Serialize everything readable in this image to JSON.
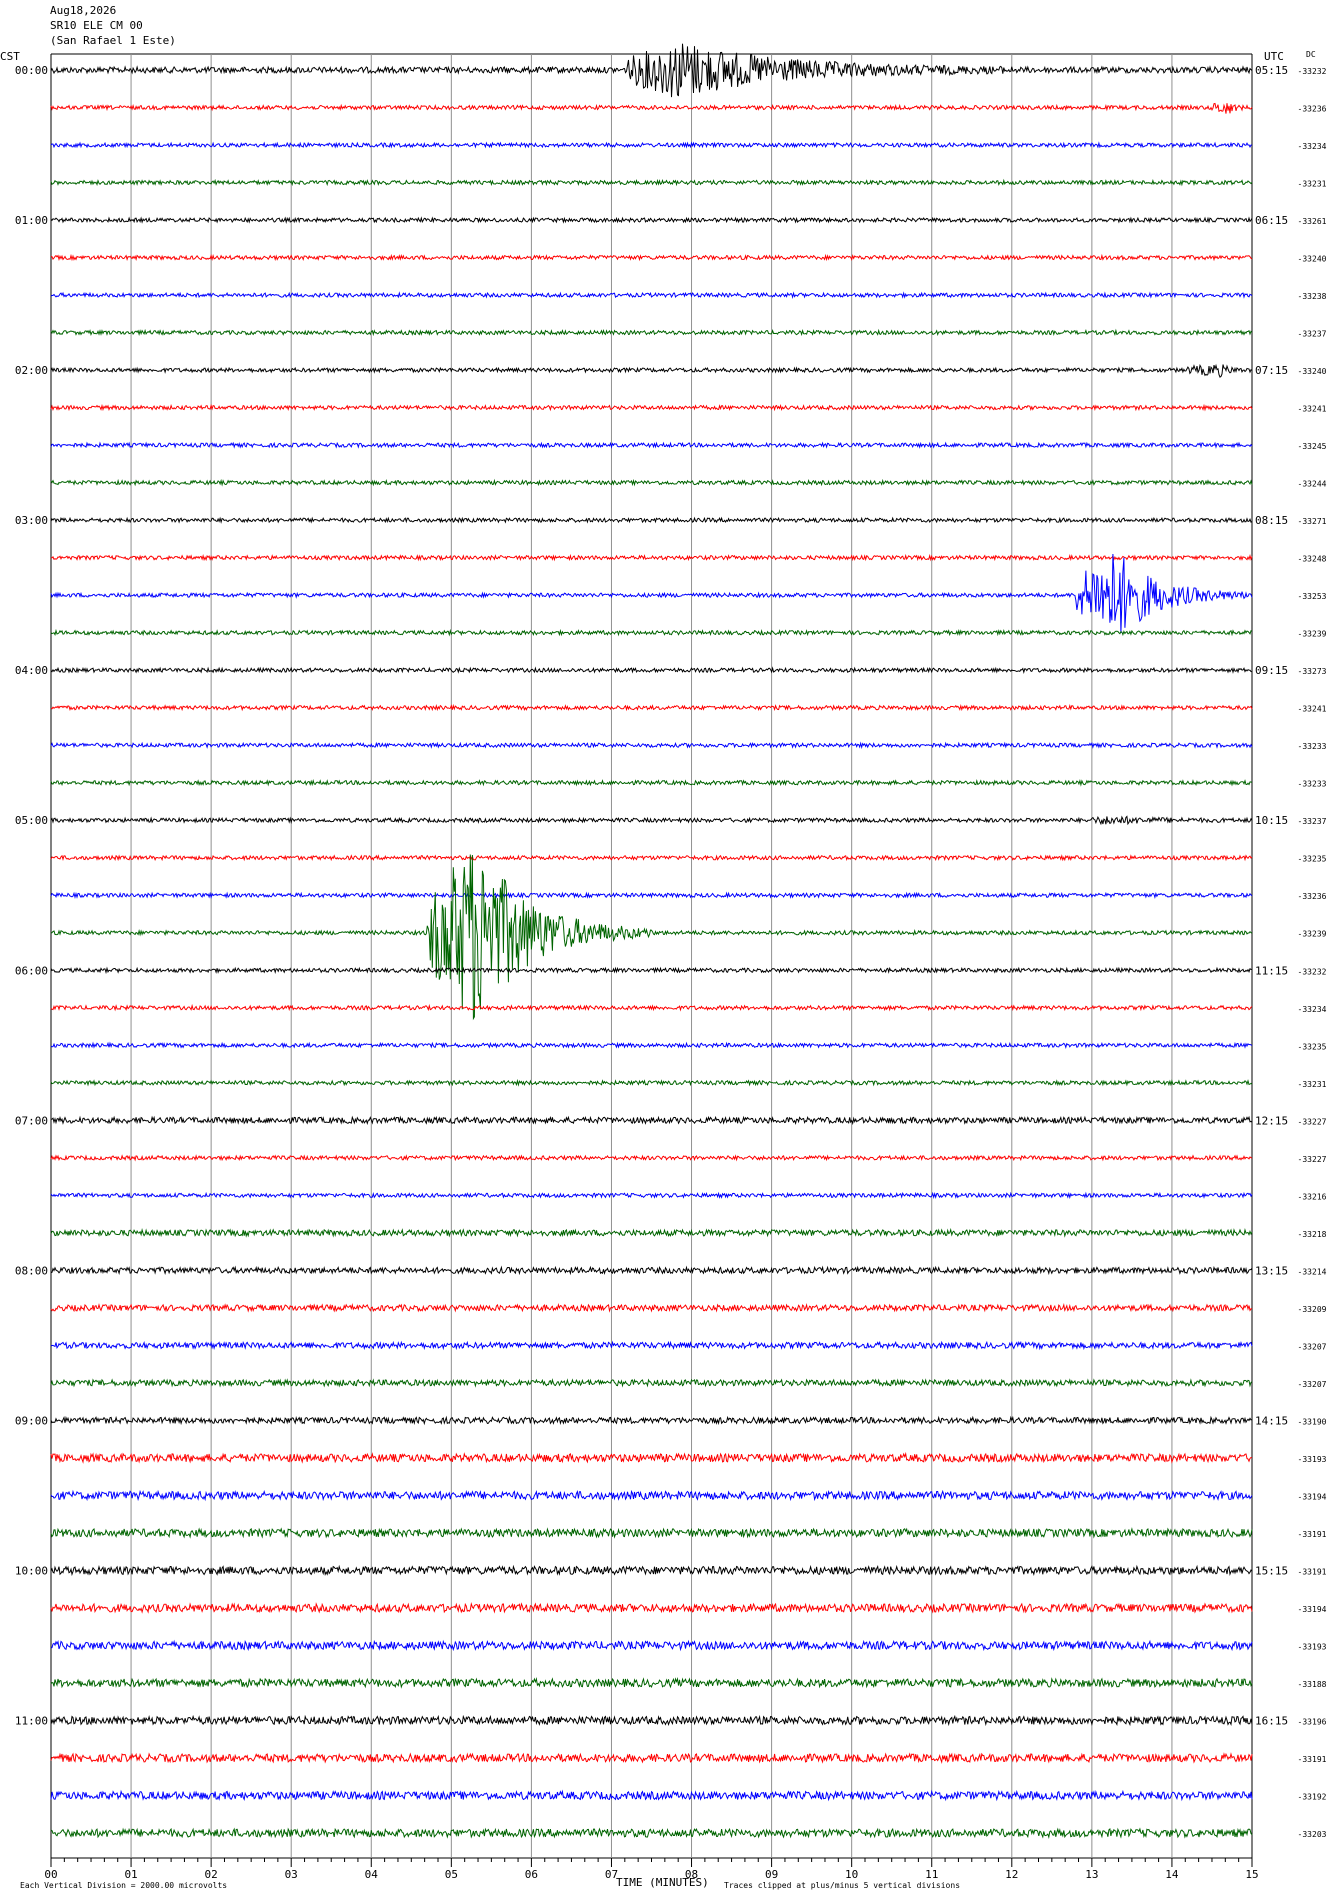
{
  "header": {
    "date": "Aug18,2026",
    "station": "SR10 ELE CM 00",
    "location": "(San Rafael 1 Este)"
  },
  "left_timezone": "CST",
  "right_timezone": "UTC",
  "right_column_label": "DC",
  "footer": {
    "scale_note": "Each Vertical Division = 2000.00 microvolts",
    "xlabel": "TIME (MINUTES)",
    "clip_note": "Traces clipped at plus/minus 5 vertical divisions"
  },
  "chart_data": {
    "type": "line",
    "title": "SR10 ELE CM 00 (San Rafael 1 Este) Aug18,2026",
    "xlabel": "TIME (MINUTES)",
    "xlim": [
      0,
      15
    ],
    "x_ticks": [
      "00",
      "01",
      "02",
      "03",
      "04",
      "05",
      "06",
      "07",
      "08",
      "09",
      "10",
      "11",
      "12",
      "13",
      "14",
      "15"
    ],
    "grid": true,
    "trace_colors": [
      "#000000",
      "#ff0000",
      "#0000ff",
      "#006400"
    ],
    "hour_labels_cst": [
      "00:00",
      "01:00",
      "02:00",
      "03:00",
      "04:00",
      "05:00",
      "06:00",
      "07:00",
      "08:00",
      "09:00",
      "10:00",
      "11:00"
    ],
    "hour_labels_utc": [
      "05:15",
      "06:15",
      "07:15",
      "08:15",
      "09:15",
      "10:15",
      "11:15",
      "12:15",
      "13:15",
      "14:15",
      "15:15",
      "16:15"
    ],
    "dc_offsets": [
      "-33232",
      "-33236",
      "-33234",
      "-33231",
      "-33261",
      "-33240",
      "-33238",
      "-33237",
      "-33240",
      "-33241",
      "-33245",
      "-33244",
      "-33271",
      "-33248",
      "-33253",
      "-33239",
      "-33273",
      "-33241",
      "-33233",
      "-33233",
      "-33237",
      "-33235",
      "-33236",
      "-33239",
      "-33232",
      "-33234",
      "-33235",
      "-33231",
      "-33227",
      "-33227",
      "-33216",
      "-33218",
      "-33214",
      "-33209",
      "-33207",
      "-33207",
      "-33190",
      "-33193",
      "-33194",
      "-33191",
      "-33191",
      "-33194",
      "-33193",
      "-33188",
      "-33196",
      "-33191",
      "-33192",
      "-33203"
    ],
    "noise_levels": [
      3,
      2,
      2,
      2,
      2,
      2,
      2,
      2,
      2,
      2,
      2,
      2,
      2,
      2,
      2,
      2,
      2,
      2,
      2,
      2,
      2,
      2,
      2,
      2,
      2,
      2,
      2,
      2,
      3,
      2,
      2,
      3,
      3,
      3,
      3,
      3,
      3,
      4,
      4,
      4,
      4,
      4,
      4,
      4,
      4,
      4,
      4,
      4
    ],
    "events": [
      {
        "trace": 0,
        "start_min": 7.2,
        "peak_min": 7.85,
        "end_min": 12.0,
        "amplitude": 28,
        "color": "#000000"
      },
      {
        "trace": 1,
        "start_min": 14.5,
        "peak_min": 14.7,
        "end_min": 14.95,
        "amplitude": 6,
        "color": "#ff0000"
      },
      {
        "trace": 8,
        "start_min": 14.2,
        "peak_min": 14.6,
        "end_min": 15.0,
        "amplitude": 5,
        "color": "#000000"
      },
      {
        "trace": 14,
        "start_min": 12.8,
        "peak_min": 13.3,
        "end_min": 15.0,
        "amplitude": 45,
        "color": "#0000ff"
      },
      {
        "trace": 20,
        "start_min": 13.0,
        "peak_min": 13.2,
        "end_min": 15.0,
        "amplitude": 3,
        "color": "#000000"
      },
      {
        "trace": 23,
        "start_min": 4.7,
        "peak_min": 5.3,
        "end_min": 7.5,
        "amplitude": 95,
        "color": "#006400"
      }
    ]
  }
}
